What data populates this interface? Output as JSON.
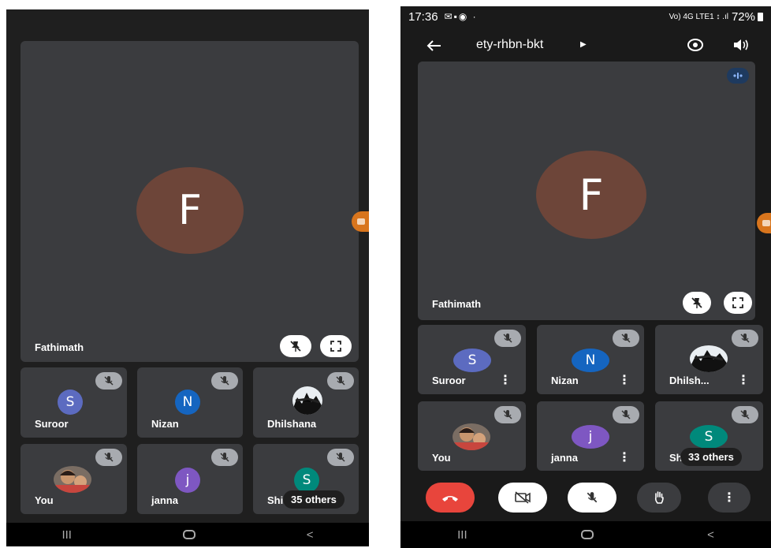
{
  "left": {
    "main_tile": {
      "initial": "F",
      "name": "Fathimath"
    },
    "tiles": [
      {
        "name": "Suroor",
        "initial": "S",
        "color": "#5c6bc0"
      },
      {
        "name": "Nizan",
        "initial": "N",
        "color": "#1565c0"
      },
      {
        "name": "Dhilshana"
      },
      {
        "name": "You"
      },
      {
        "name": "janna",
        "initial": "j",
        "color": "#7e57c2"
      },
      {
        "name": "Shi",
        "initial": "S",
        "color": "#00897b"
      }
    ],
    "others_label": "35 others"
  },
  "right": {
    "status": {
      "time": "17:36",
      "network": "Vo) 4G LTE1 ↕ .ıl",
      "battery": "72%"
    },
    "meeting_code": "ety-rhbn-bkt",
    "main_tile": {
      "initial": "F",
      "name": "Fathimath"
    },
    "tiles": [
      {
        "name": "Suroor",
        "initial": "S",
        "color": "#5c6bc0"
      },
      {
        "name": "Nizan",
        "initial": "N",
        "color": "#1565c0"
      },
      {
        "name": "Dhilsh..."
      },
      {
        "name": "You"
      },
      {
        "name": "janna",
        "initial": "j",
        "color": "#7e57c2"
      },
      {
        "name": "Shi",
        "initial": "S",
        "color": "#00897b"
      }
    ],
    "others_label": "33 others"
  },
  "colors": {
    "avatar_f": "#6d4539",
    "end_call": "#e8453c",
    "tile": "#3b3c3f",
    "background": "#1f1f1f"
  },
  "icons": [
    "mic-off-icon",
    "pin-off-icon",
    "fullscreen-icon",
    "back-arrow-icon",
    "switch-camera-icon",
    "speaker-icon",
    "end-call-icon",
    "camera-off-icon",
    "hand-raise-icon",
    "more-options-icon",
    "audio-indicator-icon"
  ]
}
